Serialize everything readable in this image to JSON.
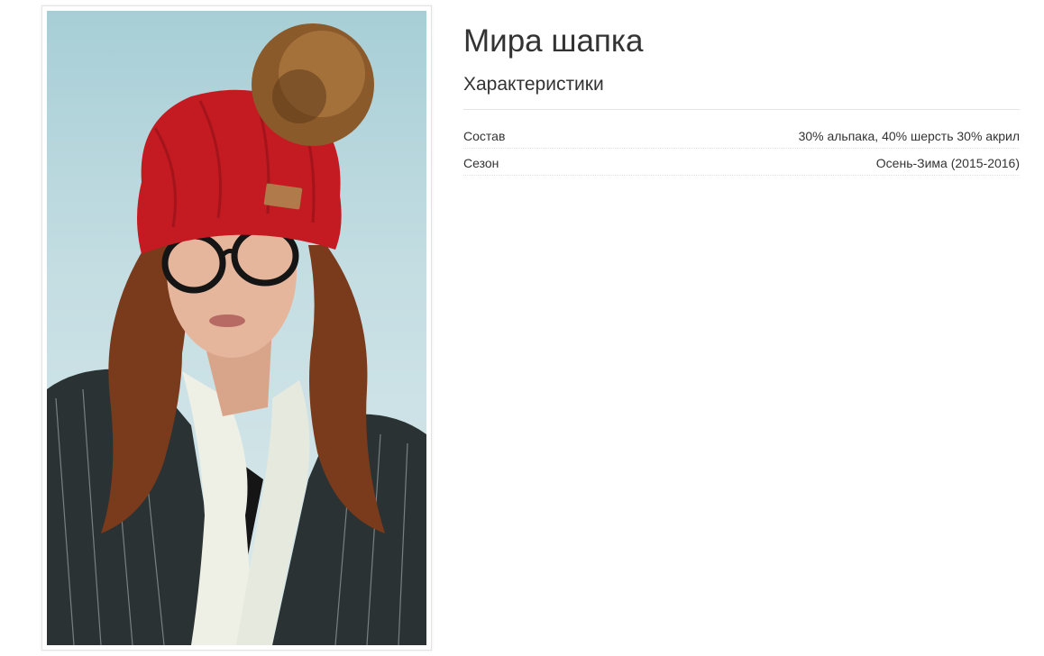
{
  "product": {
    "title": "Мира шапка",
    "image_alt": "photo of model wearing red knitted hat with fur pom-pom"
  },
  "characteristics": {
    "heading": "Характеристики",
    "rows": [
      {
        "label": "Состав",
        "value": "30% альпака, 40% шерсть 30% акрил"
      },
      {
        "label": "Сезон",
        "value": "Осень-Зима (2015-2016)"
      }
    ]
  },
  "colors": {
    "hat": "#c41a22",
    "pompom": "#8a5a2b",
    "background": "#b7d7dd",
    "jacket": "#2a3233",
    "scarf": "#eef0e6",
    "hair": "#7a3a1c"
  }
}
